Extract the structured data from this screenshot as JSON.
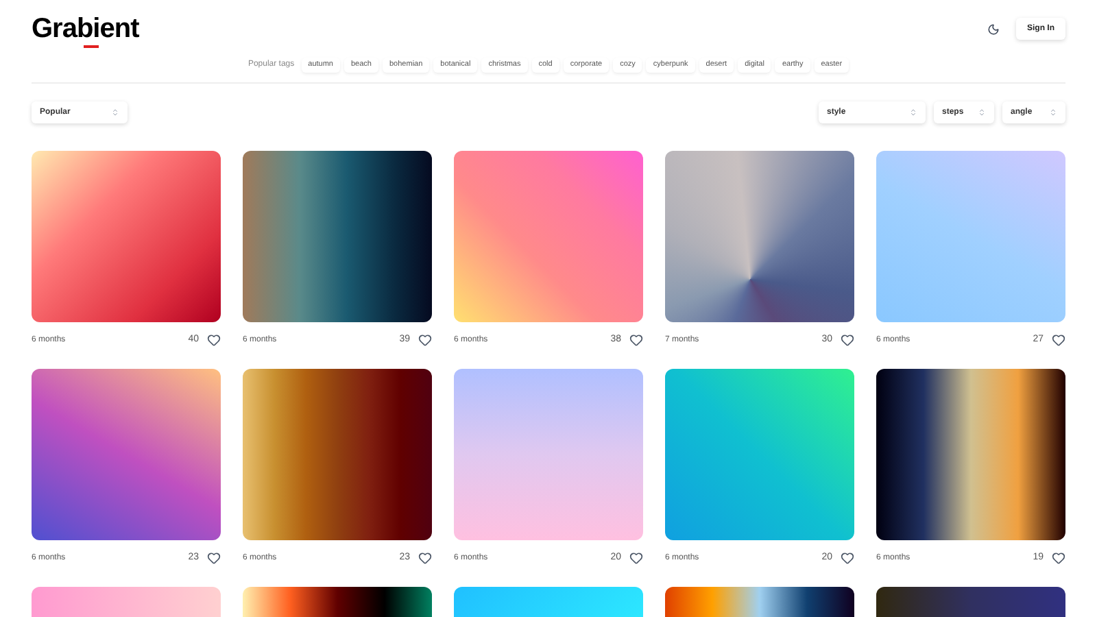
{
  "logo": "Grabient",
  "header": {
    "sign_in": "Sign In"
  },
  "tags": {
    "label": "Popular tags",
    "items": [
      "autumn",
      "beach",
      "bohemian",
      "botanical",
      "christmas",
      "cold",
      "corporate",
      "cozy",
      "cyberpunk",
      "desert",
      "digital",
      "earthy",
      "easter"
    ]
  },
  "filters": {
    "sort": "Popular",
    "style": "style",
    "steps": "steps",
    "angle": "angle"
  },
  "cards": [
    {
      "age": "6 months",
      "likes": "40"
    },
    {
      "age": "6 months",
      "likes": "39"
    },
    {
      "age": "6 months",
      "likes": "38"
    },
    {
      "age": "7 months",
      "likes": "30"
    },
    {
      "age": "6 months",
      "likes": "27"
    },
    {
      "age": "6 months",
      "likes": "23"
    },
    {
      "age": "6 months",
      "likes": "23"
    },
    {
      "age": "6 months",
      "likes": "20"
    },
    {
      "age": "6 months",
      "likes": "20"
    },
    {
      "age": "6 months",
      "likes": "19"
    }
  ]
}
